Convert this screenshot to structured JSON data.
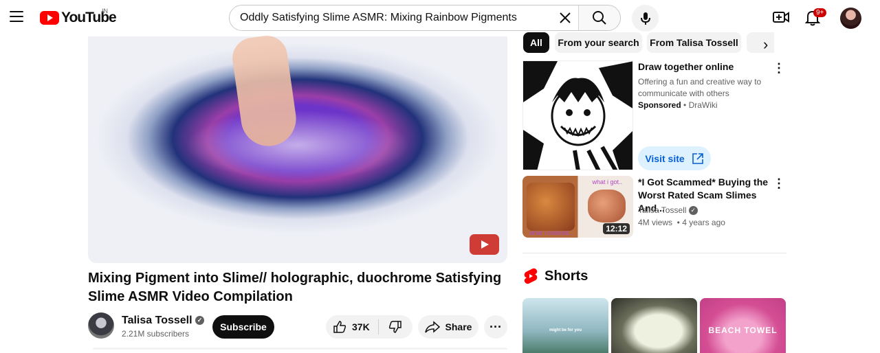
{
  "header": {
    "logo_text": "YouTube",
    "region": "IN",
    "search_value": "Oddly Satisfying Slime ASMR: Mixing Rainbow Pigments",
    "notification_count": "9+"
  },
  "video": {
    "title": "Mixing Pigment into Slime// holographic, duochrome Satisfying Slime ASMR Video Compilation",
    "channel": "Talisa Tossell",
    "subscribers": "2.21M subscribers",
    "subscribe_label": "Subscribe",
    "likes": "37K",
    "share_label": "Share"
  },
  "chips": [
    "All",
    "From your search",
    "From Talisa Tossell"
  ],
  "ad": {
    "title": "Draw together online",
    "description": "Offering a fun and creative way to communicate with others",
    "sponsored": "Sponsored",
    "advertiser": "DraWiki",
    "cta": "Visit site"
  },
  "recommendation": {
    "title": "*I Got Scammed* Buying the Worst Rated Scam Slimes And...",
    "channel": "Talisa Tossell",
    "views": "4M views",
    "age": "4 years ago",
    "duration": "12:12",
    "thumb_label_top": "what i got..",
    "thumb_label_bottom": "what i ordered..."
  },
  "shorts": {
    "heading": "Shorts",
    "items": [
      {
        "label": "might be for you"
      },
      {
        "label": ""
      },
      {
        "label": "BEACH TOWEL"
      }
    ]
  },
  "colors": {
    "brand_red": "#ff0000",
    "link_blue": "#065fd4"
  }
}
